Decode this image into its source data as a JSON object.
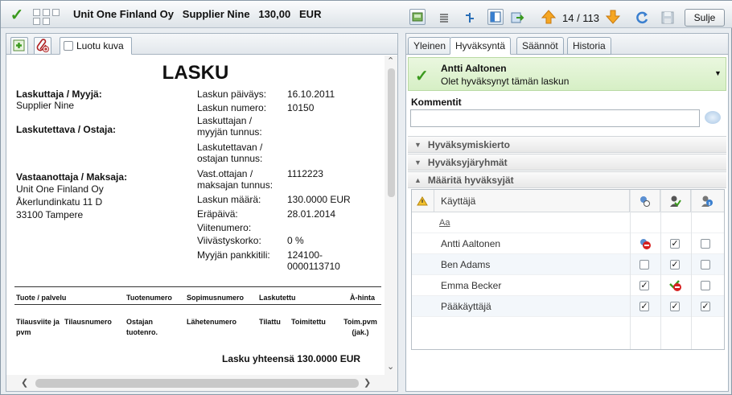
{
  "header": {
    "title": "Unit One Finland Oy   Supplier Nine   130,00   EUR",
    "counter": "14 / 113",
    "close_label": "Sulje",
    "icons": [
      "approved-check-icon",
      "view-image-icon",
      "view-list-icon",
      "split-icon",
      "left-panel-icon",
      "export-icon",
      "arrow-up-icon",
      "arrow-down-icon",
      "refresh-icon",
      "save-icon"
    ]
  },
  "left_panel": {
    "tabs": {
      "image_label": "Luotu kuva"
    },
    "document": {
      "title": "LASKU",
      "seller_label": "Laskuttaja / Myyjä:",
      "seller_name": "Supplier Nine",
      "buyer_label": "Laskutettava / Ostaja:",
      "payer_label": "Vastaanottaja / Maksaja:",
      "payer_lines": [
        "Unit One Finland Oy",
        "Åkerlundinkatu 11 D",
        "33100 Tampere"
      ],
      "fields": [
        {
          "label": "Laskun päiväys:",
          "value": "16.10.2011"
        },
        {
          "label": "Laskun numero:",
          "value": "10150"
        },
        {
          "label": "Laskuttajan / myyjän tunnus:",
          "value": ""
        },
        {
          "label": "Laskutettavan / ostajan tunnus:",
          "value": ""
        },
        {
          "label": "Vast.ottajan / maksajan tunnus:",
          "value": "1112223"
        },
        {
          "label": "Laskun määrä:",
          "value": "130.0000 EUR"
        },
        {
          "label": "Eräpäivä:",
          "value": "28.01.2014"
        },
        {
          "label": "Viitenumero:",
          "value": ""
        },
        {
          "label": "Viivästyskorko:",
          "value": "0 %"
        },
        {
          "label": "Myyjän pankkitili:",
          "value": "124100-0000113710"
        }
      ],
      "table_headers_1": [
        "Tuote / palvelu",
        "Tuotenumero",
        "Sopimusnumero",
        "Laskutettu",
        "À-hinta"
      ],
      "table_headers_2": [
        "Tilausviite ja pvm",
        "Tilausnumero",
        "Ostajan tuotenro.",
        "Lähetenumero",
        "Tilattu",
        "Toimitettu",
        "Toim.pvm (jak.)"
      ],
      "total": "Lasku yhteensä 130.0000 EUR"
    }
  },
  "right_panel": {
    "tabs": [
      "Yleinen",
      "Hyväksyntä",
      "Säännöt",
      "Historia"
    ],
    "active_tab": "Hyväksyntä",
    "status": {
      "name": "Antti Aaltonen",
      "message": "Olet hyväksynyt tämän laskun"
    },
    "comment_label": "Kommentit",
    "sections": [
      "Hyväksymiskierto",
      "Hyväksyjäryhmät",
      "Määritä hyväksyjät"
    ],
    "grid": {
      "user_header": "Käyttäjä",
      "filter_label": "Aa",
      "rows": [
        {
          "user": "Antti Aaltonen",
          "col1": "denied",
          "col2": "checked",
          "col3": "unchecked"
        },
        {
          "user": "Ben Adams",
          "col1": "unchecked",
          "col2": "checked",
          "col3": "unchecked"
        },
        {
          "user": "Emma Becker",
          "col1": "checked",
          "col2": "denied",
          "col3": "unchecked"
        },
        {
          "user": "Pääkäyttäjä",
          "col1": "checked",
          "col2": "checked",
          "col3": "checked"
        }
      ]
    }
  }
}
